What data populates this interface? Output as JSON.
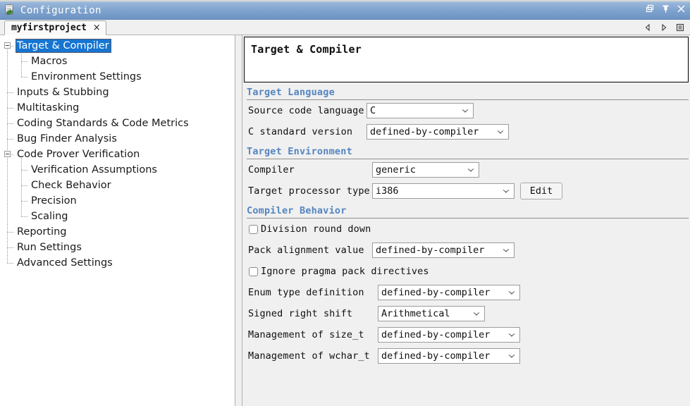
{
  "window": {
    "title": "Configuration",
    "icon": "config-document-icon",
    "buttons": [
      {
        "name": "restore-button",
        "glyph": "restore"
      },
      {
        "name": "pin-button",
        "glyph": "pin"
      },
      {
        "name": "close-button",
        "glyph": "close"
      }
    ]
  },
  "tab": {
    "label": "myfirstproject",
    "close": "×"
  },
  "tabnav": [
    {
      "name": "nav-previous-icon",
      "glyph": "left-triangle"
    },
    {
      "name": "nav-next-icon",
      "glyph": "right-triangle"
    },
    {
      "name": "tab-list-icon",
      "glyph": "list"
    }
  ],
  "tree": {
    "items": [
      {
        "label": "Target & Compiler",
        "level": 0,
        "expander": "minus",
        "selected": true
      },
      {
        "label": "Macros",
        "level": 1,
        "expander": "none",
        "selected": false
      },
      {
        "label": "Environment Settings",
        "level": 1,
        "expander": "none",
        "selected": false
      },
      {
        "label": "Inputs & Stubbing",
        "level": 0,
        "expander": "none",
        "selected": false
      },
      {
        "label": "Multitasking",
        "level": 0,
        "expander": "none",
        "selected": false
      },
      {
        "label": "Coding Standards & Code Metrics",
        "level": 0,
        "expander": "none",
        "selected": false
      },
      {
        "label": "Bug Finder Analysis",
        "level": 0,
        "expander": "none",
        "selected": false
      },
      {
        "label": "Code Prover Verification",
        "level": 0,
        "expander": "minus",
        "selected": false
      },
      {
        "label": "Verification Assumptions",
        "level": 1,
        "expander": "none",
        "selected": false
      },
      {
        "label": "Check Behavior",
        "level": 1,
        "expander": "none",
        "selected": false
      },
      {
        "label": "Precision",
        "level": 1,
        "expander": "none",
        "selected": false
      },
      {
        "label": "Scaling",
        "level": 1,
        "expander": "none",
        "selected": false
      },
      {
        "label": "Reporting",
        "level": 0,
        "expander": "none",
        "selected": false
      },
      {
        "label": "Run Settings",
        "level": 0,
        "expander": "none",
        "selected": false
      },
      {
        "label": "Advanced Settings",
        "level": 0,
        "expander": "none",
        "selected": false
      }
    ]
  },
  "panel": {
    "title": "Target & Compiler",
    "sections": [
      {
        "title": "Target Language",
        "rows": [
          {
            "kind": "combo",
            "label": "Source code language",
            "value": "C",
            "label_w": 168,
            "combo_w": 152
          },
          {
            "kind": "combo",
            "label": "C standard version",
            "value": "defined-by-compiler",
            "label_w": 168,
            "combo_w": 202
          }
        ]
      },
      {
        "title": "Target Environment",
        "rows": [
          {
            "kind": "combo",
            "label": "Compiler",
            "value": "generic",
            "label_w": 176,
            "combo_w": 152
          },
          {
            "kind": "combo-btn",
            "label": "Target processor type",
            "value": "i386",
            "button": "Edit",
            "label_w": 176,
            "combo_w": 202
          }
        ]
      },
      {
        "title": "Compiler Behavior",
        "rows": [
          {
            "kind": "check",
            "label": "Division round down",
            "checked": false
          },
          {
            "kind": "combo",
            "label": "Pack alignment value",
            "value": "defined-by-compiler",
            "label_w": 176,
            "combo_w": 202
          },
          {
            "kind": "check",
            "label": "Ignore pragma pack directives",
            "checked": false
          },
          {
            "kind": "combo",
            "label": "Enum type definition",
            "value": "defined-by-compiler",
            "label_w": 184,
            "combo_w": 202
          },
          {
            "kind": "combo",
            "label": "Signed right shift",
            "value": "Arithmetical",
            "label_w": 184,
            "combo_w": 152
          },
          {
            "kind": "combo",
            "label": "Management of size_t",
            "value": "defined-by-compiler",
            "label_w": 184,
            "combo_w": 202
          },
          {
            "kind": "combo",
            "label": "Management of wchar_t",
            "value": "defined-by-compiler",
            "label_w": 184,
            "combo_w": 202
          }
        ]
      }
    ]
  },
  "colors": {
    "titlebar_from": "#b8cde4",
    "titlebar_to": "#6d93c4",
    "selection": "#1675d1",
    "section_header": "#5585c0",
    "panel_bg": "#f0f0f0"
  }
}
